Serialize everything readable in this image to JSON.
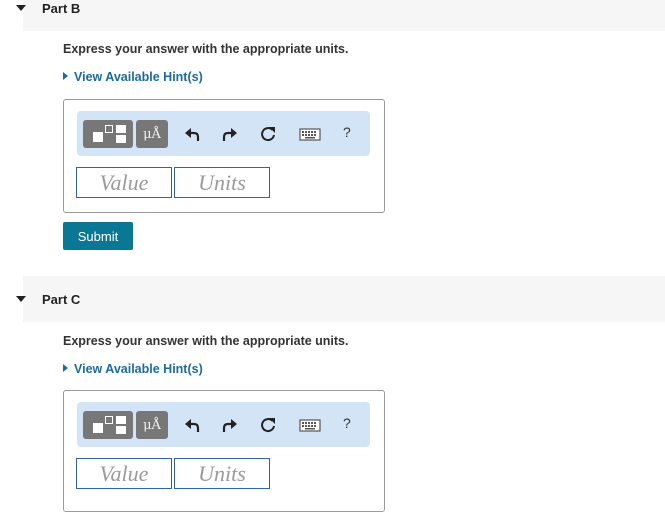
{
  "parts": [
    {
      "title": "Part B",
      "instruction": "Express your answer with the appropriate units.",
      "hint_label": "View Available Hint(s)",
      "value_placeholder": "Value",
      "units_placeholder": "Units",
      "units_button_label": "μÅ",
      "help_label": "?"
    },
    {
      "title": "Part C",
      "instruction": "Express your answer with the appropriate units.",
      "hint_label": "View Available Hint(s)",
      "value_placeholder": "Value",
      "units_placeholder": "Units",
      "units_button_label": "μÅ",
      "help_label": "?"
    }
  ],
  "submit_label": "Submit",
  "colors": {
    "header_bg": "#f6f6f6",
    "toolbar_bg": "#d3e4f7",
    "link": "#1b6aa5",
    "submit_bg": "#0a7895",
    "field_border": "#2f63a8"
  }
}
